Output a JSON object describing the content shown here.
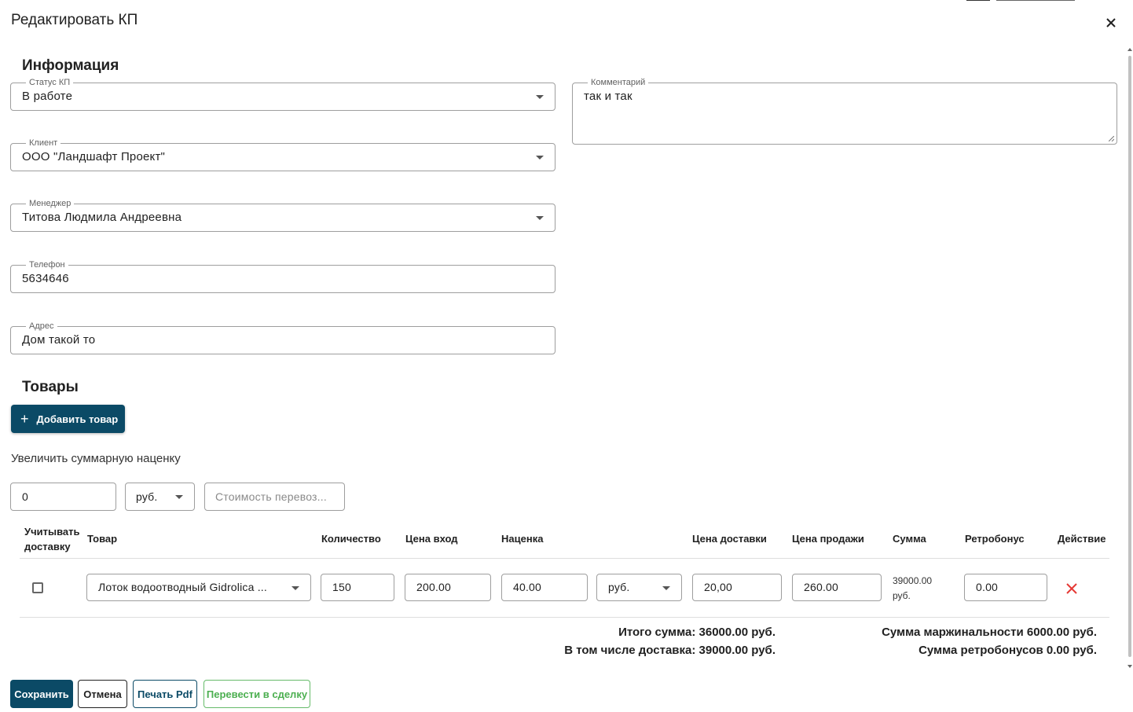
{
  "dialog": {
    "title": "Редактировать КП"
  },
  "info": {
    "heading": "Информация",
    "status": {
      "label": "Статус КП",
      "value": "В работе"
    },
    "client": {
      "label": "Клиент",
      "value": "ООО \"Ландшафт Проект\""
    },
    "manager": {
      "label": "Менеджер",
      "value": "Титова Людмила Андреевна"
    },
    "phone": {
      "label": "Телефон",
      "value": "5634646"
    },
    "address": {
      "label": "Адрес",
      "value": "Дом такой то"
    },
    "comment": {
      "label": "Комментарий",
      "value": "так и так"
    }
  },
  "goods": {
    "heading": "Товары",
    "add_button": "Добавить товар",
    "markup_label": "Увеличить суммарную наценку",
    "markup_value": "0",
    "markup_unit": "руб.",
    "transport_placeholder": "Стоимость перевоз...",
    "columns": {
      "delivery_line1": "Учитывать",
      "delivery_line2": "доставку",
      "product": "Товар",
      "quantity": "Количество",
      "price_in": "Цена вход",
      "markup": "Наценка",
      "delivery_price": "Цена доставки",
      "sale_price": "Цена продажи",
      "sum": "Сумма",
      "retro": "Ретробонус",
      "action": "Действие"
    },
    "row": {
      "include_delivery": false,
      "product": "Лоток водоотводный Gidrolica ...",
      "quantity": "150",
      "price_in": "200.00",
      "markup": "40.00",
      "markup_unit": "руб.",
      "delivery_price": "20,00",
      "sale_price": "260.00",
      "sum_line1": "39000.00",
      "sum_line2": "руб.",
      "retro": "0.00"
    },
    "totals": {
      "total": "Итого сумма: 36000.00 руб.",
      "delivery_included": "В том числе доставка: 39000.00 руб.",
      "margin": "Сумма маржинальности 6000.00 руб.",
      "retro_sum": "Сумма ретробонусов 0.00 руб."
    }
  },
  "footer": {
    "save": "Сохранить",
    "cancel": "Отмена",
    "print": "Печать Pdf",
    "to_deal": "Перевести в сделку"
  },
  "colors": {
    "primary": "#0b4a66",
    "success": "#4caf50",
    "danger": "#e53935"
  },
  "icons": [
    "close-icon",
    "caret-down-icon",
    "plus-icon",
    "delete-icon"
  ]
}
